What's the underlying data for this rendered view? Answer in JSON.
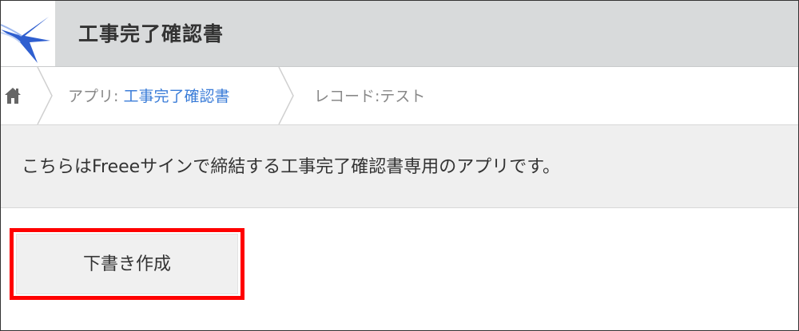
{
  "header": {
    "app_title": "工事完了確認書",
    "app_icon": "swallow-bird-icon"
  },
  "breadcrumb": {
    "home_icon": "home-icon",
    "app_prefix": "アプリ:",
    "app_link": "工事完了確認書",
    "record_prefix": "レコード:",
    "record_name": "テスト"
  },
  "description": {
    "text": "こちらはFreeeサインで締結する工事完了確認書専用のアプリです。"
  },
  "actions": {
    "draft_button_label": "下書き作成"
  },
  "colors": {
    "header_bg": "#d8dadb",
    "link": "#3b7dd8",
    "highlight": "#ff0000",
    "icon_blue": "#2f5fd0"
  }
}
